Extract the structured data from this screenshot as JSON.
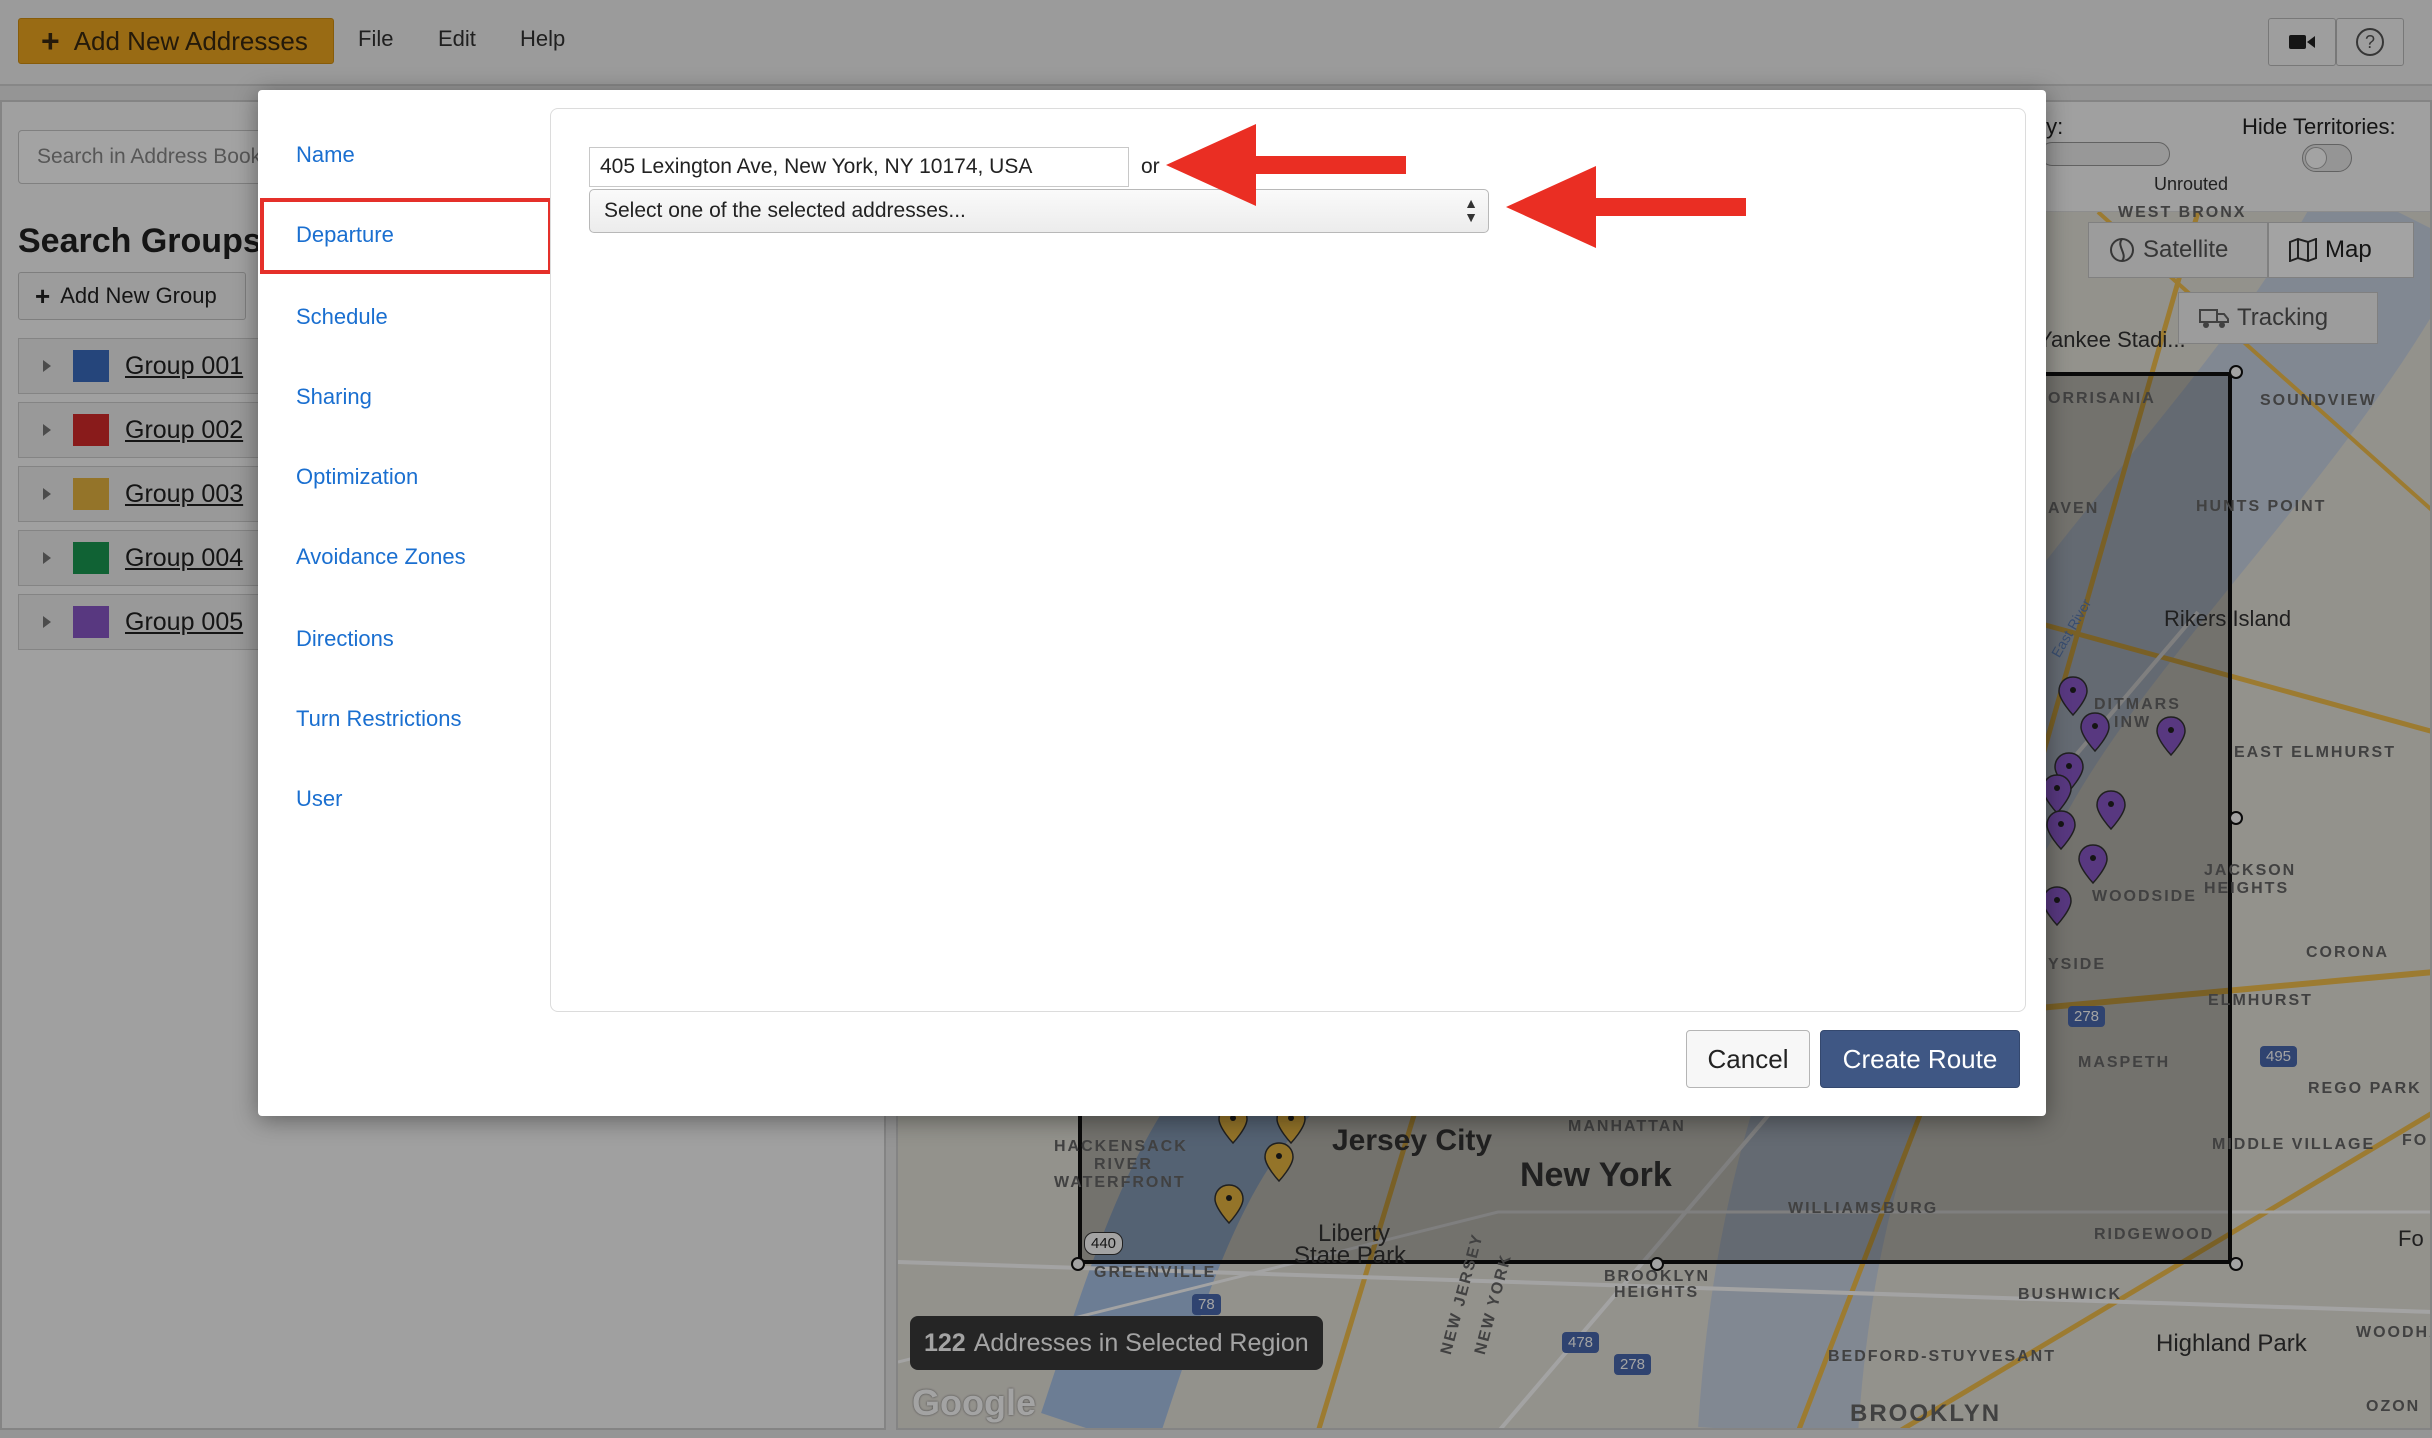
{
  "toolbar": {
    "add_addresses_label": "Add New Addresses",
    "menu": [
      "File",
      "Edit",
      "Help"
    ]
  },
  "left_panel": {
    "search_placeholder": "Search in Address Book",
    "groups_title": "Search Groups",
    "add_group_label": "Add New Group",
    "groups": [
      {
        "name": "Group 001",
        "color": "#3a6cc0"
      },
      {
        "name": "Group 002",
        "color": "#d62b2b"
      },
      {
        "name": "Group 003",
        "color": "#e8b640"
      },
      {
        "name": "Group 004",
        "color": "#1a9a52"
      },
      {
        "name": "Group 005",
        "color": "#8a58c8"
      }
    ]
  },
  "map": {
    "filter_label": "ty:",
    "filter_value": "Unrouted",
    "hide_territories_label": "Hide Territories:",
    "satellite_label": "Satellite",
    "map_label": "Map",
    "tracking_label": "Tracking",
    "places": {
      "west_bronx": "WEST BRONX",
      "yankee": "Yankee Stadi...",
      "morrisania": "ORRISANIA",
      "soundview": "SOUNDVIEW",
      "raven": "AVEN",
      "hunts_point": "HUNTS POINT",
      "rikers": "Rikers Island",
      "ditmars": "DITMARS",
      "ditmars2": "INW",
      "east_elmhurst": "EAST ELMHURST",
      "jackson": "JACKSON",
      "jackson2": "HEIGHTS",
      "woodside": "WOODSIDE",
      "corona": "CORONA",
      "sunnyside": "YSIDE",
      "elmhurst": "ELMHURST",
      "maspeth": "MASPETH",
      "rego_park": "REGO PARK",
      "middle_village": "MIDDLE VILLAGE",
      "fo": "Fo",
      "fo2": "FO",
      "hackensack": "HACKENSACK",
      "river": "RIVER",
      "waterfront": "WATERFRONT",
      "jersey_city": "Jersey City",
      "manhattan": "MANHATTAN",
      "new_york": "New York",
      "williamsburg": "WILLIAMSBURG",
      "ridgewood": "RIDGEWOOD",
      "liberty": "Liberty",
      "liberty2": "State Park",
      "greenville": "GREENVILLE",
      "brooklyn_heights": "BROOKLYN",
      "brooklyn_heights2": "HEIGHTS",
      "bushwick": "BUSHWICK",
      "highland_park": "Highland Park",
      "woodha": "WOODHA",
      "bedford": "BEDFORD-STUYVESANT",
      "brooklyn": "BROOKLYN",
      "ozon": "OZON",
      "new_jersey": "NEW JERSEY",
      "new_york_state": "NEW YORK",
      "east_river": "East River"
    },
    "highway_shields": [
      "278",
      "495",
      "440",
      "78",
      "478",
      "278"
    ],
    "address_count": "122",
    "address_count_label": "Addresses in Selected Region",
    "google": "Google"
  },
  "modal": {
    "nav": [
      "Name",
      "Departure",
      "Schedule",
      "Sharing",
      "Optimization",
      "Avoidance Zones",
      "Directions",
      "Turn Restrictions",
      "User"
    ],
    "active_nav": "Departure",
    "address_value": "405 Lexington Ave, New York, NY 10174, USA",
    "or_label": "or",
    "select_value": "Select one of the selected addresses...",
    "cancel_label": "Cancel",
    "create_label": "Create Route"
  },
  "colors": {
    "accent_blue": "#3f5784",
    "link_blue": "#1a6fd0",
    "highlight_red": "#e5302a",
    "add_button_orange": "#f0a820"
  }
}
